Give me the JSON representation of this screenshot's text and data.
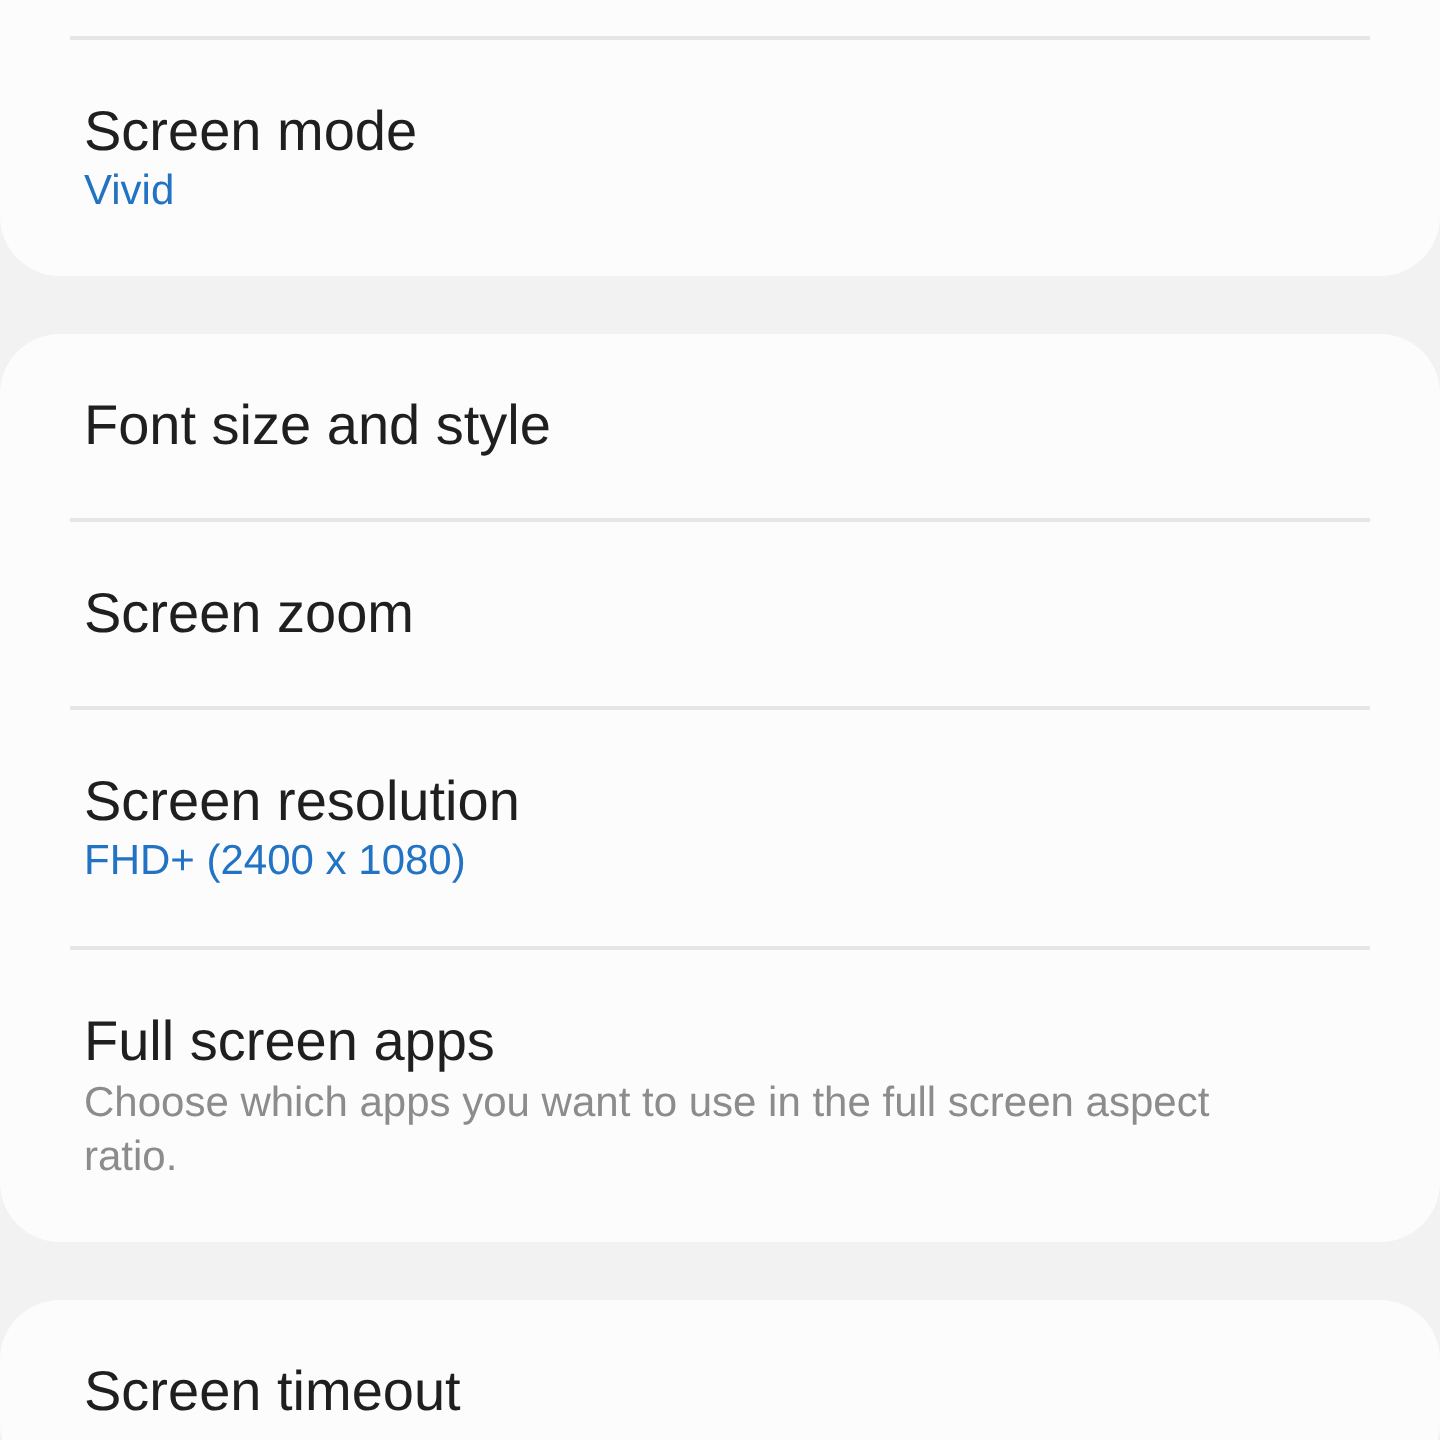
{
  "groups": [
    {
      "items": [
        {
          "title": "Screen mode",
          "value": "Vivid"
        }
      ]
    },
    {
      "items": [
        {
          "title": "Font size and style"
        },
        {
          "title": "Screen zoom"
        },
        {
          "title": "Screen resolution",
          "value": "FHD+ (2400 x 1080)"
        },
        {
          "title": "Full screen apps",
          "description": "Choose which apps you want to use in the full screen aspect ratio."
        }
      ]
    },
    {
      "items": [
        {
          "title": "Screen timeout"
        }
      ]
    }
  ]
}
